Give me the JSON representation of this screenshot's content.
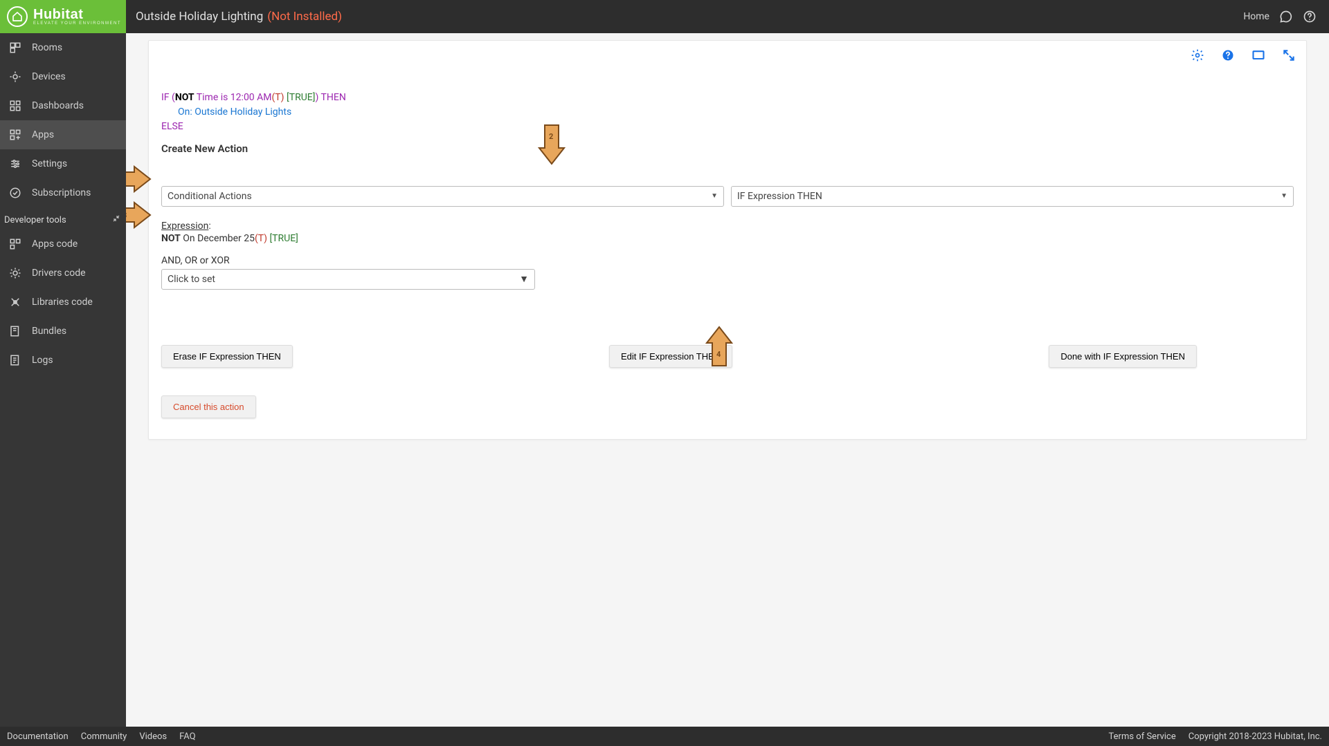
{
  "header": {
    "app_name": "Outside Holiday Lighting",
    "status": "(Not Installed)",
    "home_label": "Home"
  },
  "sidebar": {
    "items": [
      {
        "label": "Rooms"
      },
      {
        "label": "Devices"
      },
      {
        "label": "Dashboards"
      },
      {
        "label": "Apps"
      },
      {
        "label": "Settings"
      },
      {
        "label": "Subscriptions"
      }
    ],
    "dev_section_label": "Developer tools",
    "dev_items": [
      {
        "label": "Apps code"
      },
      {
        "label": "Drivers code"
      },
      {
        "label": "Libraries code"
      },
      {
        "label": "Bundles"
      },
      {
        "label": "Logs"
      }
    ]
  },
  "rule": {
    "if_prefix": "IF (",
    "not": "NOT",
    "if_body": " Time is 12:00 AM",
    "if_t": "(T)",
    "if_true": " [TRUE]",
    "if_suffix": ") THEN",
    "action_line": "On: Outside Holiday Lights",
    "else": "ELSE",
    "create_label": "Create New Action"
  },
  "dropdowns": {
    "conditional": "Conditional Actions",
    "ifexpr": "IF Expression THEN"
  },
  "expression": {
    "label": "Expression",
    "colon": ":",
    "not": "NOT",
    "body": " On December 25",
    "t": "(T)",
    "true": " [TRUE]"
  },
  "andor": {
    "label": "AND, OR or XOR",
    "placeholder": "Click to set"
  },
  "buttons": {
    "erase": "Erase IF Expression THEN",
    "edit": "Edit IF Expression THEN",
    "done": "Done with IF Expression THEN",
    "cancel": "Cancel this action"
  },
  "footer": {
    "left": [
      "Documentation",
      "Community",
      "Videos",
      "FAQ"
    ],
    "right": [
      "Terms of Service",
      "Copyright 2018-2023 Hubitat, Inc."
    ]
  }
}
